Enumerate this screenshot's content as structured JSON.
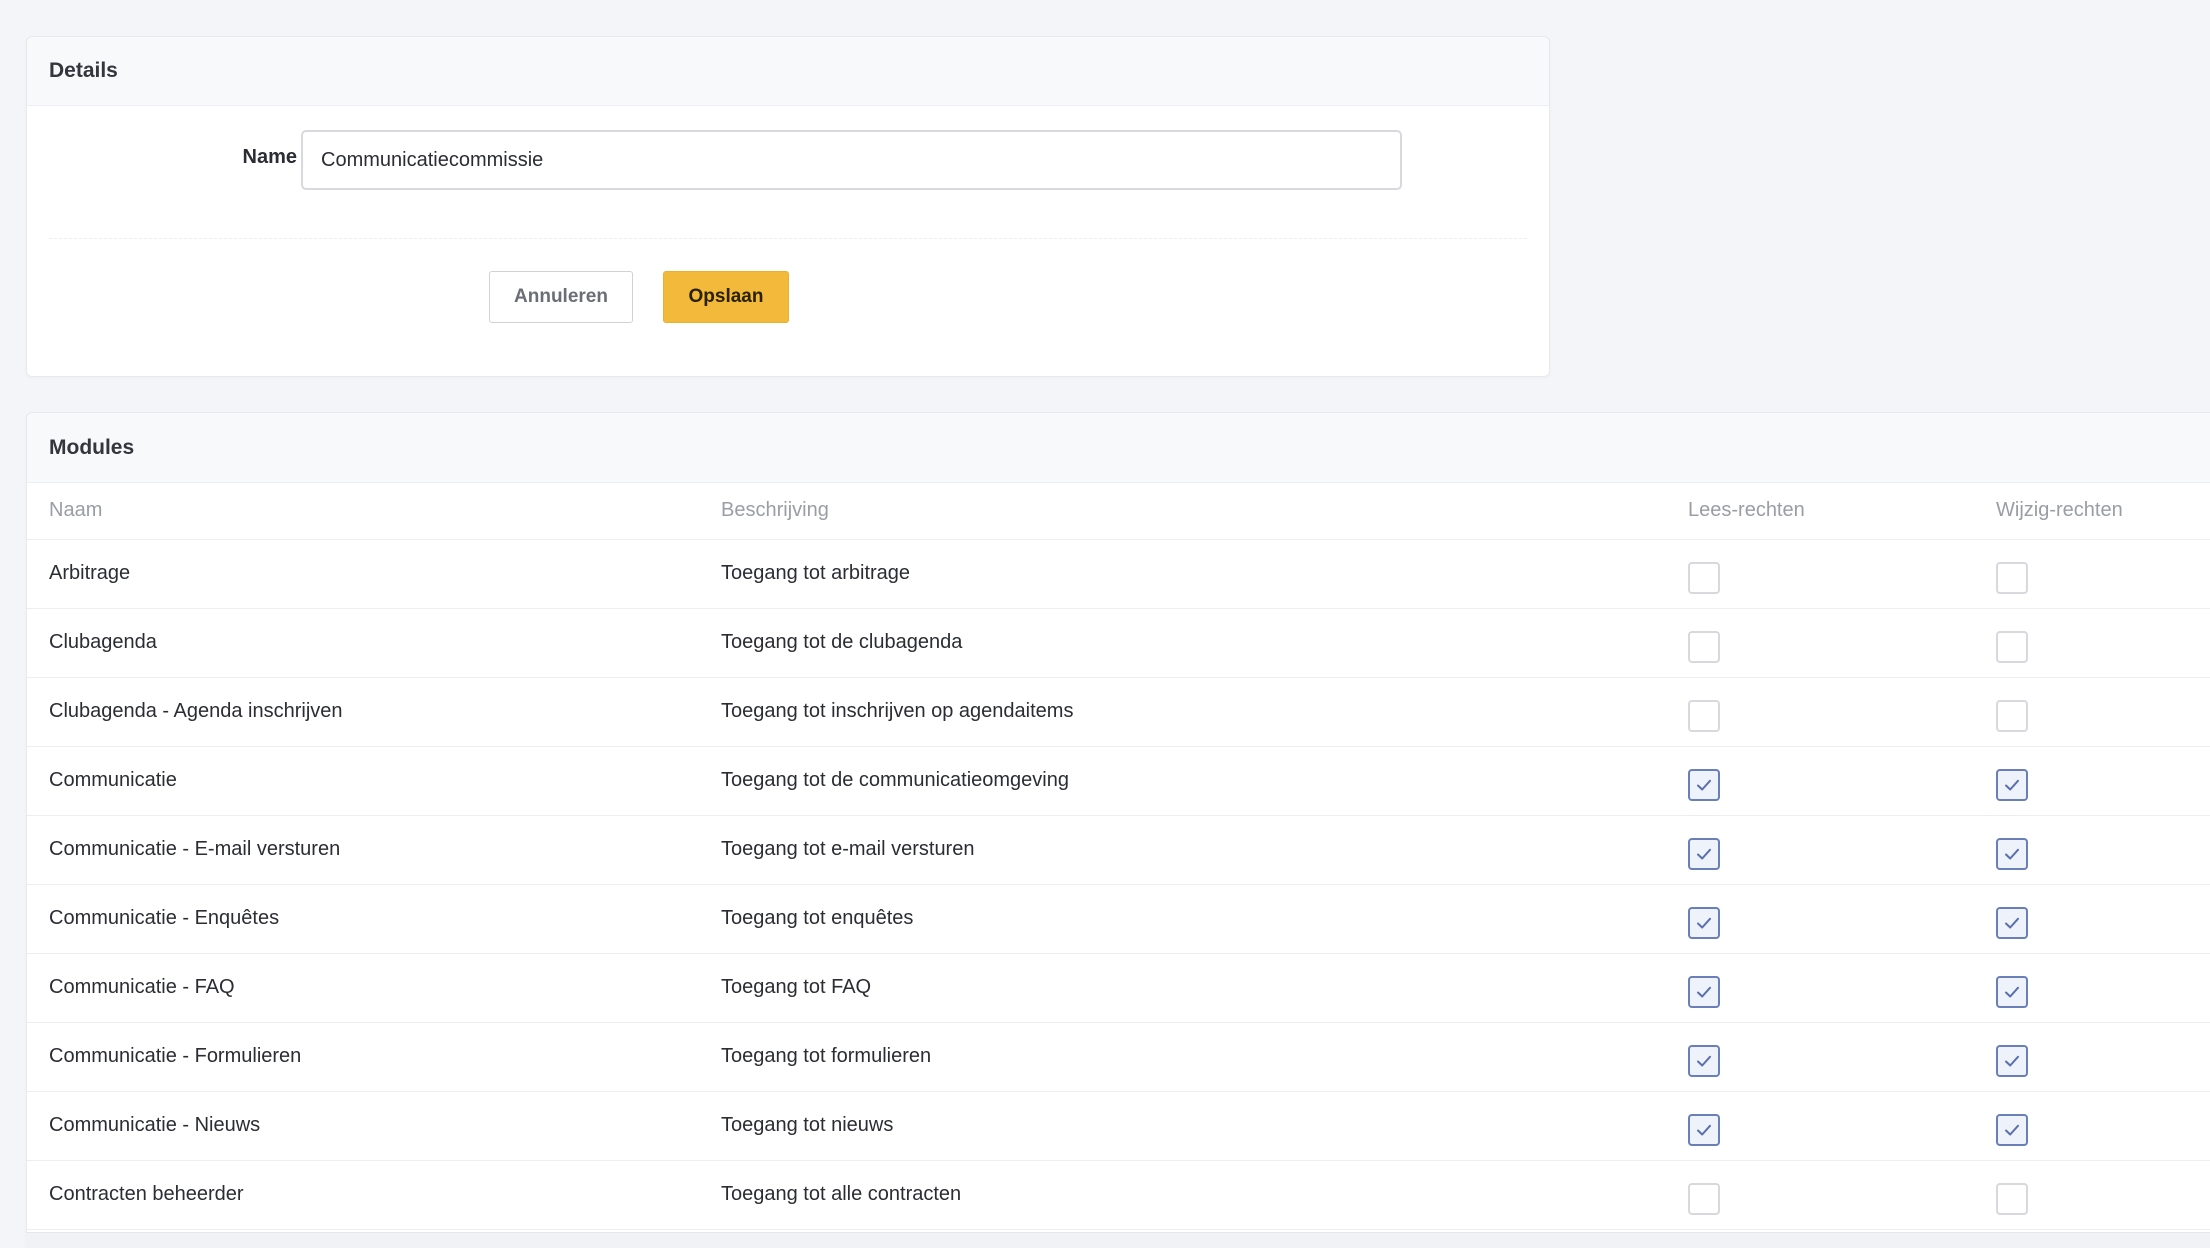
{
  "details": {
    "title": "Details",
    "name_label": "Name",
    "name_value": "Communicatiecommissie",
    "cancel_label": "Annuleren",
    "save_label": "Opslaan"
  },
  "modules": {
    "title": "Modules",
    "columns": {
      "name": "Naam",
      "description": "Beschrijving",
      "read": "Lees-rechten",
      "write": "Wijzig-rechten"
    },
    "rows": [
      {
        "name": "Arbitrage",
        "description": "Toegang tot arbitrage",
        "read": false,
        "write": false
      },
      {
        "name": "Clubagenda",
        "description": "Toegang tot de clubagenda",
        "read": false,
        "write": false
      },
      {
        "name": "Clubagenda - Agenda inschrijven",
        "description": "Toegang tot inschrijven op agendaitems",
        "read": false,
        "write": false
      },
      {
        "name": "Communicatie",
        "description": "Toegang tot de communicatieomgeving",
        "read": true,
        "write": true
      },
      {
        "name": "Communicatie - E-mail versturen",
        "description": "Toegang tot e-mail versturen",
        "read": true,
        "write": true
      },
      {
        "name": "Communicatie - Enquêtes",
        "description": "Toegang tot enquêtes",
        "read": true,
        "write": true
      },
      {
        "name": "Communicatie - FAQ",
        "description": "Toegang tot FAQ",
        "read": true,
        "write": true
      },
      {
        "name": "Communicatie - Formulieren",
        "description": "Toegang tot formulieren",
        "read": true,
        "write": true
      },
      {
        "name": "Communicatie - Nieuws",
        "description": "Toegang tot nieuws",
        "read": true,
        "write": true
      },
      {
        "name": "Contracten beheerder",
        "description": "Toegang tot alle contracten",
        "read": false,
        "write": false
      }
    ]
  },
  "icons": {
    "check": "check-icon"
  },
  "colors": {
    "accent": "#f3b93a",
    "checkbox_checked": "#6a7fb8"
  }
}
